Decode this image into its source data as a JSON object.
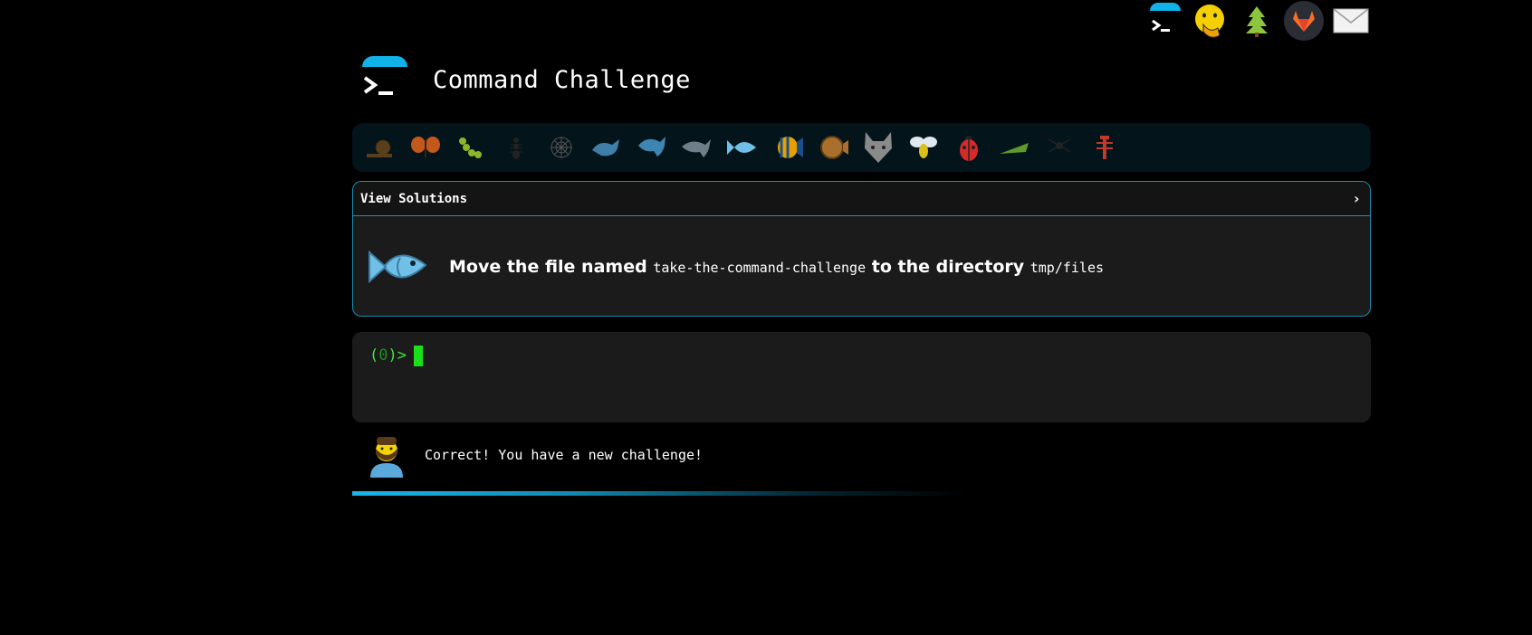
{
  "app": {
    "title": "Command Challenge"
  },
  "topnav": [
    "terminal-icon",
    "hand-over-mouth-icon",
    "tree-icon",
    "gitlab-icon",
    "envelope-icon"
  ],
  "levels": [
    "snail",
    "butterfly",
    "caterpillar",
    "ant",
    "spider-web",
    "whale",
    "shark",
    "dolphin",
    "fish",
    "tropical-fish",
    "blowfish",
    "wolf",
    "bee",
    "ladybug",
    "cricket",
    "spider",
    "scorpion"
  ],
  "challenge": {
    "view_solutions_label": "View Solutions",
    "chevron": "›",
    "text_before": "Move the file named ",
    "code_file": "take-the-command-challenge",
    "text_middle": " to the directory ",
    "code_dir": "tmp/files"
  },
  "terminal": {
    "prompt_open": "(",
    "prompt_num": "0",
    "prompt_close": ")>"
  },
  "feedback": {
    "message": "Correct! You have a new challenge!"
  },
  "colors": {
    "accent": "#0fb3ea",
    "panel": "#1b1b1b",
    "prompt": "#3fe33a",
    "cursor": "#19e019"
  }
}
